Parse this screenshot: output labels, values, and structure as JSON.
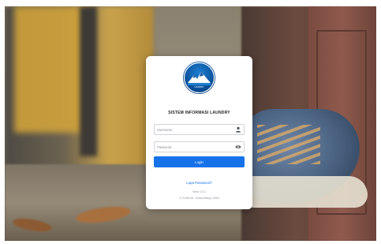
{
  "app": {
    "title": "SISTEM INFORMASI LAUNDRY",
    "logo_icon": "mountain-logo-icon"
  },
  "form": {
    "username_placeholder": "Username",
    "username_value": "",
    "username_icon": "user-icon",
    "password_placeholder": "Password",
    "password_value": "",
    "password_icon": "eye-icon",
    "login_label": "Login"
  },
  "footer": {
    "forgot_label": "Lupa Password?",
    "version": "Versi 1.0.1",
    "copyright": "© 2106129 - Dana Wahyu 2020"
  },
  "colors": {
    "accent": "#1572e8",
    "card_bg": "#ffffff"
  }
}
